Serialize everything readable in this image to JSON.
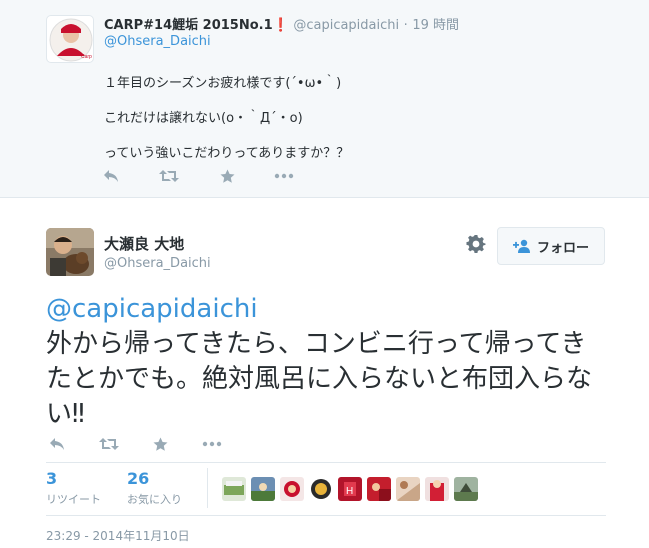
{
  "reply": {
    "name": "CARP#14鯉垢 2015No.1❗",
    "screen_name": "@capicapidaichi",
    "separator": "·",
    "time": "19 時間",
    "reply_to": "@Ohsera_Daichi",
    "lines": [
      "１年目のシーズンお疲れ様です(´•ω•｀)",
      "これだけは譲れない(o・｀Д´・o)",
      "っていう強いこだわりってありますか？？"
    ],
    "actions": [
      "reply-icon",
      "retweet-icon",
      "favorite-icon",
      "more-icon"
    ]
  },
  "tweet": {
    "name": "大瀬良 大地",
    "handle": "@Ohsera_Daichi",
    "follow_label": "フォロー",
    "mention": "@capicapidaichi",
    "text": "外から帰ってきたら、コンビニ行って帰ってきたとかでも。絶対風呂に入らないと布団入らない‼",
    "actions": [
      "reply-icon",
      "retweet-icon",
      "favorite-icon",
      "more-icon"
    ],
    "stats": {
      "retweets": "3",
      "retweets_label": "リツイート",
      "favorites": "26",
      "favorites_label": "お気に入り"
    },
    "favorited_by_count": 9,
    "timestamp": "23:29 - 2014年11月10日"
  },
  "colors": {
    "link": "#3b94d9",
    "muted": "#8899a6",
    "text": "#292f33",
    "icon": "#99aab5",
    "reply_bg": "#f5f8fa"
  }
}
